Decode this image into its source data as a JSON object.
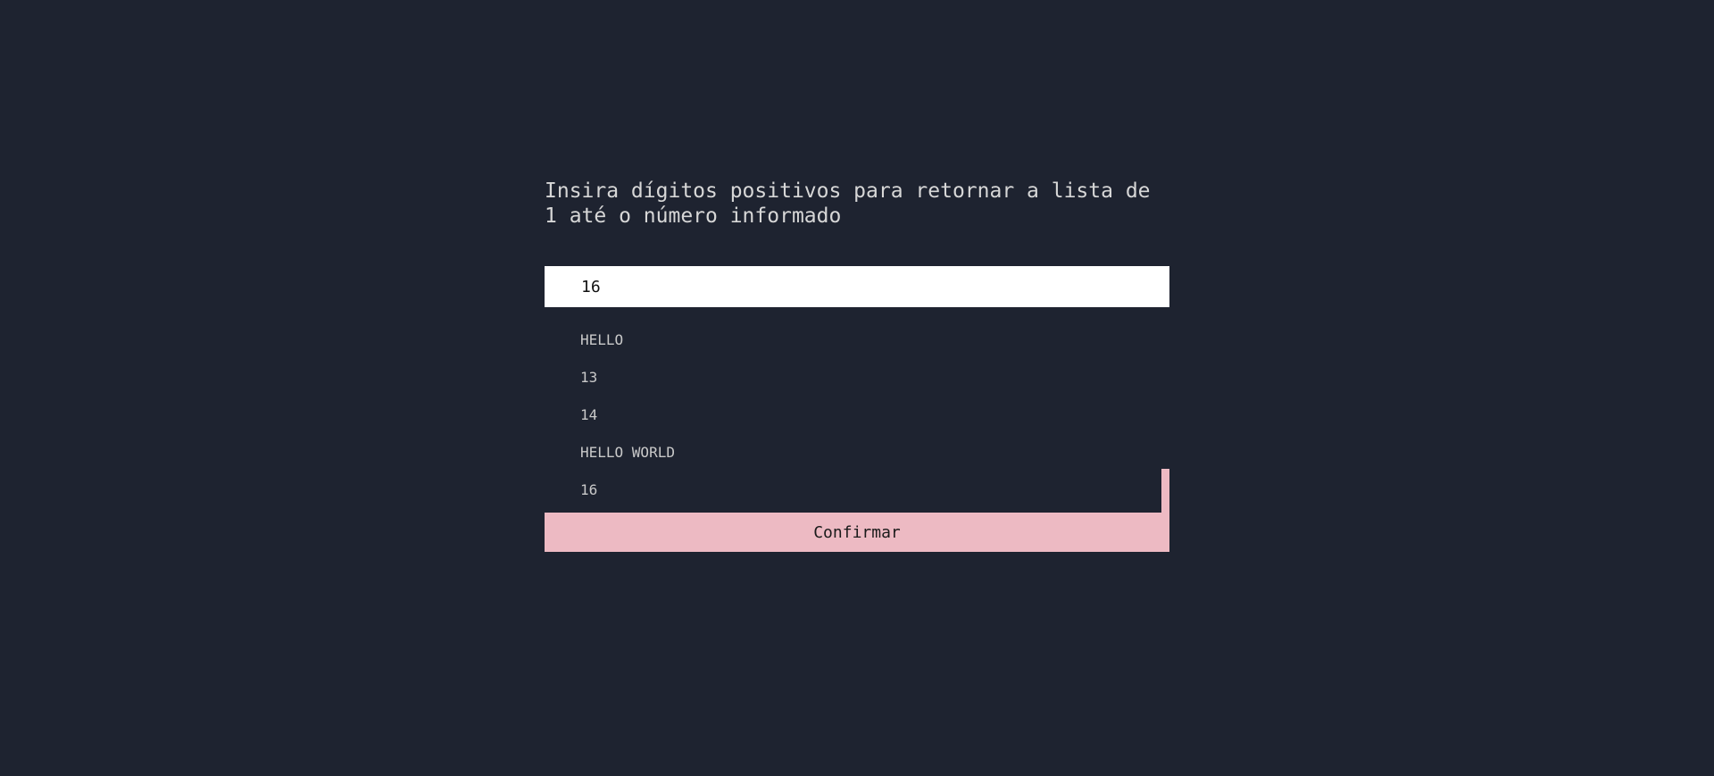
{
  "form": {
    "heading": "Insira dígitos positivos para retornar a lista de 1 até o número informado",
    "input_value": "16",
    "button_label": "Confirmar"
  },
  "results": {
    "items": [
      "HELLO",
      "13",
      "14",
      "HELLO WORLD",
      "16"
    ]
  },
  "colors": {
    "background": "#1e2330",
    "accent": "#edbac3",
    "input_background": "#ffffff"
  }
}
